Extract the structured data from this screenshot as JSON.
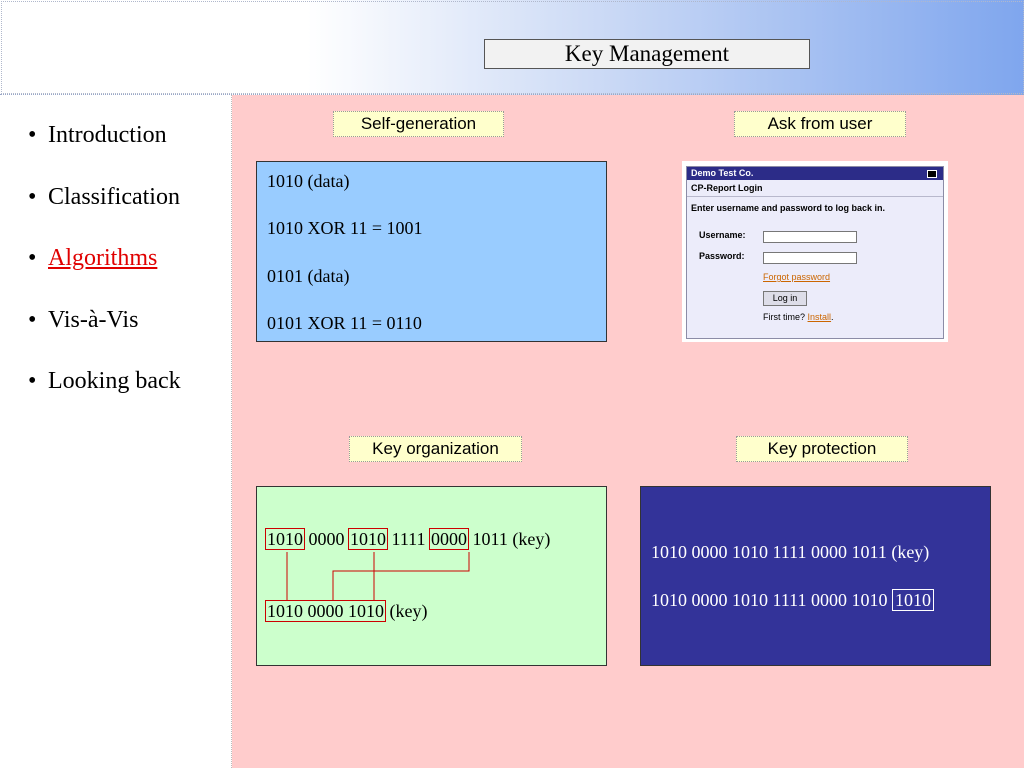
{
  "header": {
    "title": "Key Management"
  },
  "sidebar": {
    "bullet": "•",
    "items": [
      {
        "label": "Introduction"
      },
      {
        "label": "Classification"
      },
      {
        "label": "Algorithms"
      },
      {
        "label": "Vis-à-Vis"
      },
      {
        "label": "Looking back"
      }
    ],
    "active_index": 2
  },
  "sections": {
    "self_generation": {
      "label": "Self-generation",
      "lines": [
        "1010 (data)",
        "1010 XOR 11 = 1001",
        "0101 (data)",
        "0101 XOR 11 = 0110"
      ]
    },
    "ask_from_user": {
      "label": "Ask from user",
      "login": {
        "window_title": "Demo Test Co.",
        "subtitle": "CP-Report Login",
        "instruction": "Enter username and password to log back in.",
        "username_label": "Username:",
        "password_label": "Password:",
        "forgot_link": "Forgot password",
        "login_button": "Log in",
        "first_time_text": "First time?",
        "install_link": "Install",
        "period": "."
      }
    },
    "key_organization": {
      "label": "Key organization",
      "line1": {
        "seg1": "1010",
        "seg2": "0000",
        "seg3": "1010",
        "seg4": "1111",
        "seg5": "0000",
        "seg6": "1011",
        "suffix": "(key)"
      },
      "line2": {
        "boxed": "1010 0000 1010",
        "suffix": "(key)"
      }
    },
    "key_protection": {
      "label": "Key protection",
      "line1": "1010 0000 1010 1111 0000 1011 (key)",
      "line2_prefix": "1010 0000 1010 1111 0000 1010",
      "line2_boxed": "1010"
    }
  },
  "colors": {
    "content_bg": "#ffcccc",
    "label_bg": "#ffffcc",
    "self_gen_panel": "#99ccff",
    "key_org_panel": "#ccffcc",
    "key_prot_panel": "#333399",
    "active_nav": "#e00000",
    "connector": "#cc0000"
  }
}
